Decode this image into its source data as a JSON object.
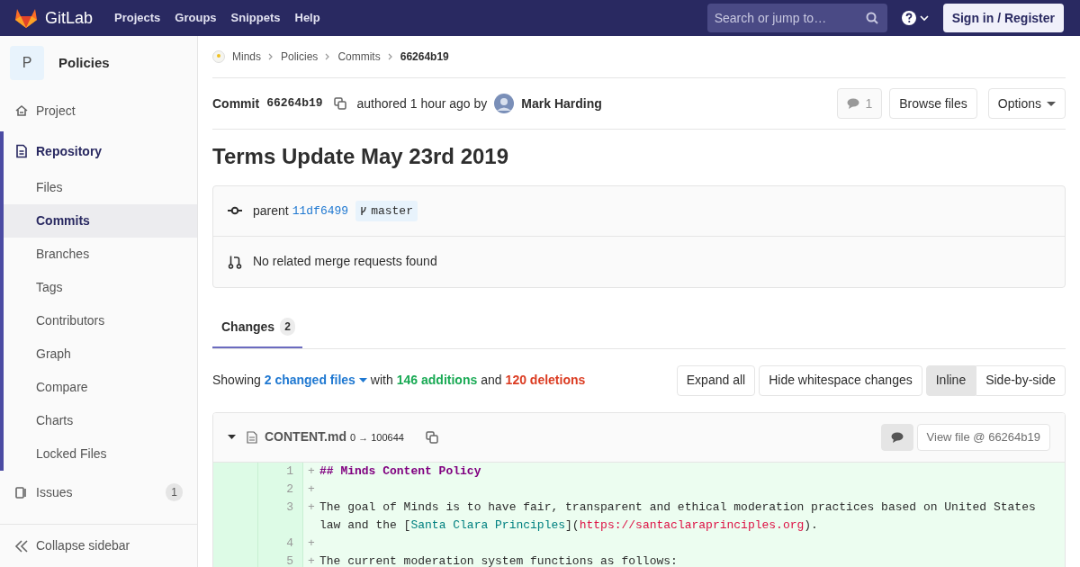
{
  "navbar": {
    "brand": "GitLab",
    "links": [
      "Projects",
      "Groups",
      "Snippets",
      "Help"
    ],
    "search": {
      "placeholder": "Search or jump to…"
    },
    "sign_in": "Sign in / Register"
  },
  "sidebar": {
    "project": {
      "avatar_letter": "P",
      "name": "Policies"
    },
    "items": [
      {
        "label": "Project",
        "kind": "plain",
        "selected": false
      },
      {
        "label": "Repository",
        "kind": "section",
        "selected": true,
        "children": [
          {
            "label": "Files",
            "selected": false
          },
          {
            "label": "Commits",
            "selected": true
          },
          {
            "label": "Branches",
            "selected": false
          },
          {
            "label": "Tags",
            "selected": false
          },
          {
            "label": "Contributors",
            "selected": false
          },
          {
            "label": "Graph",
            "selected": false
          },
          {
            "label": "Compare",
            "selected": false
          },
          {
            "label": "Charts",
            "selected": false
          },
          {
            "label": "Locked Files",
            "selected": false
          }
        ]
      },
      {
        "label": "Issues",
        "kind": "counted",
        "selected": false,
        "count": "1"
      }
    ],
    "collapse": "Collapse sidebar"
  },
  "breadcrumbs": [
    "Minds",
    "Policies",
    "Commits",
    "66264b19"
  ],
  "commit": {
    "label": "Commit",
    "sha": "66264b19",
    "authored": "authored 1 hour ago by",
    "author": "Mark Harding",
    "comments": "1",
    "browse": "Browse files",
    "options": "Options"
  },
  "title": "Terms Update May 23rd 2019",
  "info": {
    "parent_label": "parent",
    "parent_sha": "11df6499",
    "branch": "master",
    "merge_requests": "No related merge requests found"
  },
  "tabs": [
    {
      "label": "Changes",
      "count": "2",
      "selected": true
    }
  ],
  "summary": {
    "showing": "Showing",
    "files": "2 changed files",
    "with": "with",
    "additions": "146 additions",
    "and": "and",
    "deletions": "120 deletions"
  },
  "toolbar": {
    "expand": "Expand all",
    "whitespace": "Hide whitespace changes",
    "views": [
      {
        "label": "Inline",
        "selected": true
      },
      {
        "label": "Side-by-side",
        "selected": false
      }
    ]
  },
  "file": {
    "expanded": true,
    "name": "CONTENT.md",
    "mode": "0 → 100644",
    "view": "View file @ 66264b19",
    "lines": [
      {
        "new": "1",
        "sign": "+",
        "segments": [
          {
            "kind": "heading",
            "text": "## Minds Content Policy"
          }
        ]
      },
      {
        "new": "2",
        "sign": "+"
      },
      {
        "new": "3",
        "sign": "+",
        "segments": [
          {
            "kind": "plain",
            "text": "The goal of Minds is to have fair, transparent and ethical moderation practices based on United States law and the ["
          },
          {
            "kind": "link",
            "text": "Santa Clara Principles"
          },
          {
            "kind": "plain",
            "text": "]("
          },
          {
            "kind": "url",
            "text": "https://santaclaraprinciples.org"
          },
          {
            "kind": "plain",
            "text": ")."
          }
        ]
      },
      {
        "new": "4",
        "sign": "+"
      },
      {
        "new": "5",
        "sign": "+",
        "segments": [
          {
            "kind": "plain",
            "text": "The current moderation system functions as follows:"
          }
        ]
      }
    ]
  }
}
